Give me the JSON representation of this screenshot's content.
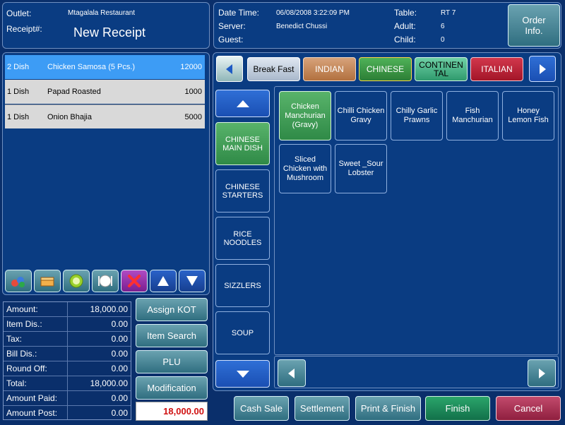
{
  "header_left": {
    "outlet_label": "Outlet:",
    "outlet_value": "Mtagalala Restaurant",
    "receipt_label": "Receipt#:",
    "receipt_value": "New Receipt"
  },
  "header_right": {
    "datetime_label": "Date Time:",
    "datetime_value": "06/08/2008 3:22:09 PM",
    "server_label": "Server:",
    "server_value": "Benedict Chussi",
    "guest_label": "Guest:",
    "table_label": "Table:",
    "table_value": "RT 7",
    "adult_label": "Adult:",
    "adult_value": "6",
    "child_label": "Child:",
    "child_value": "0",
    "order_info_label": "Order Info."
  },
  "receipt_items": [
    {
      "qty": "2 Dish",
      "name": "Chicken Samosa (5 Pcs.)",
      "price": "12000"
    },
    {
      "qty": "1 Dish",
      "name": "Papad Roasted",
      "price": "1000"
    },
    {
      "qty": "1 Dish",
      "name": "Onion Bhajia",
      "price": "5000"
    }
  ],
  "totals": [
    {
      "label": "Amount:",
      "value": "18,000.00"
    },
    {
      "label": "Item Dis.:",
      "value": "0.00"
    },
    {
      "label": "Tax:",
      "value": "0.00"
    },
    {
      "label": "Bill Dis.:",
      "value": "0.00"
    },
    {
      "label": "Round Off:",
      "value": "0.00"
    },
    {
      "label": "Total:",
      "value": "18,000.00"
    },
    {
      "label": "Amount Paid:",
      "value": "0.00"
    },
    {
      "label": "Amount Post:",
      "value": "0.00"
    }
  ],
  "side_buttons": {
    "assign_kot": "Assign KOT",
    "item_search": "Item Search",
    "plu": "PLU",
    "modification": "Modification",
    "balance": "18,000.00"
  },
  "cuisines": [
    {
      "label": "Break Fast",
      "color": "#c6d3e3"
    },
    {
      "label": "INDIAN",
      "color": "#c48a5c"
    },
    {
      "label": "CHINESE",
      "color": "#3c9a44"
    },
    {
      "label": "CONTINEN TAL",
      "color": "#48b389"
    },
    {
      "label": "ITALIAN",
      "color": "#c0263a"
    }
  ],
  "categories": [
    {
      "label": "CHINESE MAIN DISH"
    },
    {
      "label": "CHINESE STARTERS"
    },
    {
      "label": "RICE NOODLES"
    },
    {
      "label": "SIZZLERS"
    },
    {
      "label": "SOUP"
    }
  ],
  "menu_items": [
    {
      "label": "Chicken Manchurian (Gravy)"
    },
    {
      "label": "Chilli Chicken Gravy"
    },
    {
      "label": "Chilly Garlic Prawns"
    },
    {
      "label": "Fish Manchurian"
    },
    {
      "label": "Honey Lemon Fish"
    },
    {
      "label": "Sliced Chicken with Mushroom"
    },
    {
      "label": "Sweet _Sour Lobster"
    }
  ],
  "bottom_buttons": {
    "cash_sale": "Cash Sale",
    "settlement": "Settlement",
    "print_finish": "Print & Finish",
    "finish": "Finish",
    "cancel": "Cancel"
  },
  "icons": [
    "people-icon",
    "box-icon",
    "lime-icon",
    "plate-icon",
    "delete-icon",
    "up-triangle-icon",
    "down-triangle-icon"
  ]
}
